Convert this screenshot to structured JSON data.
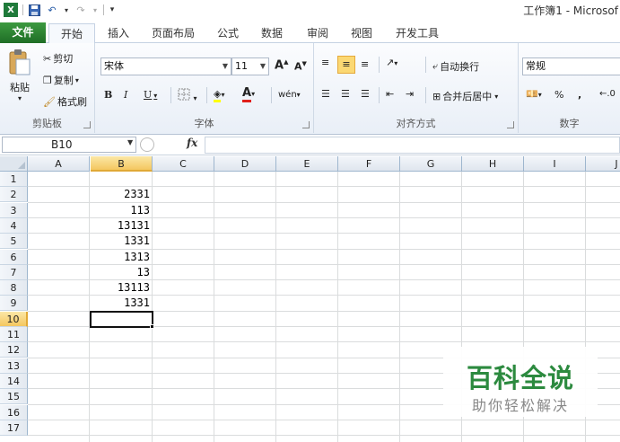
{
  "window": {
    "title": "工作簿1 - Microsof"
  },
  "tabs": [
    {
      "id": "file",
      "label": "文件"
    },
    {
      "id": "home",
      "label": "开始"
    },
    {
      "id": "insert",
      "label": "插入"
    },
    {
      "id": "layout",
      "label": "页面布局"
    },
    {
      "id": "formula",
      "label": "公式"
    },
    {
      "id": "data",
      "label": "数据"
    },
    {
      "id": "review",
      "label": "审阅"
    },
    {
      "id": "view",
      "label": "视图"
    },
    {
      "id": "dev",
      "label": "开发工具"
    }
  ],
  "ribbon": {
    "clipboard": {
      "paste": "粘贴",
      "cut": "剪切",
      "copy": "复制",
      "format_painter": "格式刷",
      "label": "剪贴板"
    },
    "font": {
      "name": "宋体",
      "size": "11",
      "grow": "A",
      "shrink": "A",
      "bold": "B",
      "italic": "I",
      "underline": "U",
      "font_color": "A",
      "label": "字体"
    },
    "alignment": {
      "wrap": "自动换行",
      "merge": "合并后居中",
      "label": "对齐方式"
    },
    "number": {
      "format": "常规",
      "percent": "%",
      "comma": ",",
      "label": "数字"
    }
  },
  "formula_bar": {
    "name_box": "B10",
    "fx": "fx",
    "value": ""
  },
  "grid": {
    "columns": [
      "A",
      "B",
      "C",
      "D",
      "E",
      "F",
      "G",
      "H",
      "I",
      "J"
    ],
    "active_column": "B",
    "rows": [
      "1",
      "2",
      "3",
      "4",
      "5",
      "6",
      "7",
      "8",
      "9",
      "10",
      "11",
      "12",
      "13",
      "14",
      "15",
      "16",
      "17"
    ],
    "active_row": "10",
    "cells": [
      {
        "ref": "B2",
        "value": "2331"
      },
      {
        "ref": "B3",
        "value": "113"
      },
      {
        "ref": "B4",
        "value": "13131"
      },
      {
        "ref": "B5",
        "value": "1331"
      },
      {
        "ref": "B6",
        "value": "1313"
      },
      {
        "ref": "B7",
        "value": "13"
      },
      {
        "ref": "B8",
        "value": "13113"
      },
      {
        "ref": "B9",
        "value": "1331"
      }
    ]
  },
  "watermark": {
    "title": "百科全说",
    "subtitle": "助你轻松解决"
  }
}
